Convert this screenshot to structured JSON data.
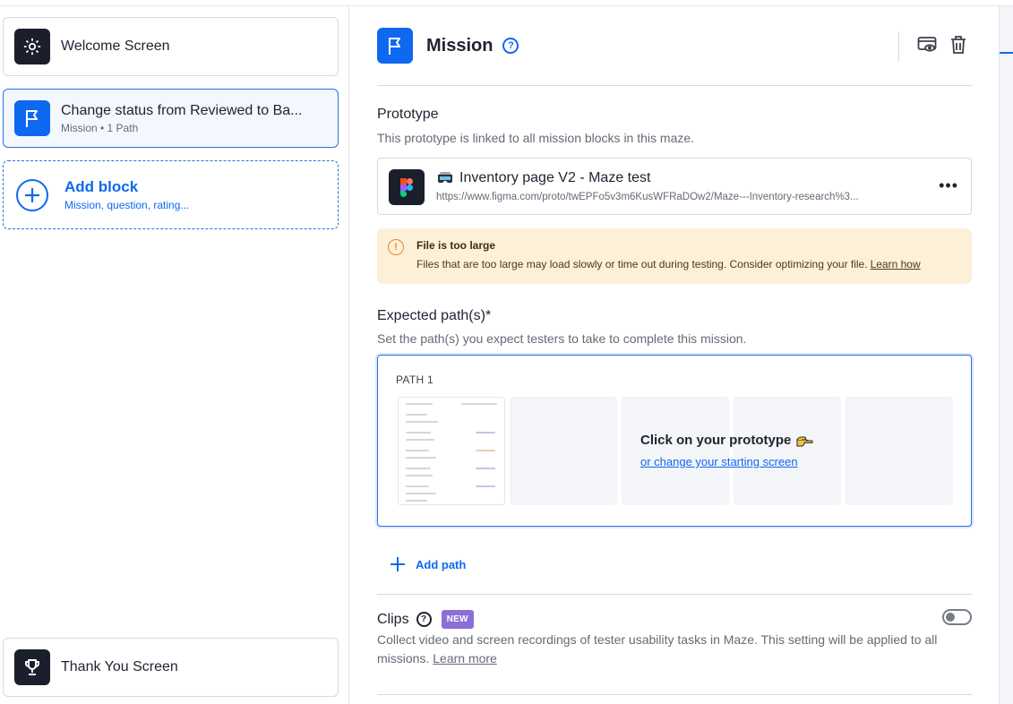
{
  "sidebar": {
    "welcome": {
      "title": "Welcome Screen",
      "icon": "gear-icon"
    },
    "mission": {
      "title": "Change status from Reviewed to Ba...",
      "subtitle": "Mission • 1 Path",
      "icon": "flag-icon"
    },
    "add_block": {
      "title": "Add block",
      "subtitle": "Mission, question, rating..."
    },
    "thank_you": {
      "title": "Thank You Screen",
      "icon": "trophy-icon"
    }
  },
  "main": {
    "header": {
      "title": "Mission",
      "help": "?"
    },
    "prototype": {
      "title": "Prototype",
      "description": "This prototype is linked to all mission blocks in this maze.",
      "name": "Inventory page V2 - Maze test",
      "url": "https://www.figma.com/proto/twEPFo5v3m6KusWFRaDOw2/Maze---Inventory-research%3...",
      "more": "•••"
    },
    "warning": {
      "icon": "!",
      "title": "File is too large",
      "text": "Files that are too large may load slowly or time out during testing. Consider optimizing your file.",
      "link": "Learn how"
    },
    "expected_paths": {
      "title": "Expected path(s)*",
      "description": "Set the path(s) you expect testers to take to complete this mission.",
      "path_label": "PATH 1",
      "cta_title": "Click on your prototype",
      "cta_link": "or change your starting screen"
    },
    "add_path": {
      "label": "Add path"
    },
    "clips": {
      "title": "Clips",
      "help": "?",
      "badge": "NEW",
      "description": "Collect video and screen recordings of tester usability tasks in Maze. This setting will be applied to all missions.",
      "link": "Learn more",
      "enabled": false
    }
  },
  "colors": {
    "accent": "#0f68f0",
    "dark": "#1b1f2b",
    "warning_bg": "#fdf0d9",
    "badge": "#8b6fd6"
  }
}
